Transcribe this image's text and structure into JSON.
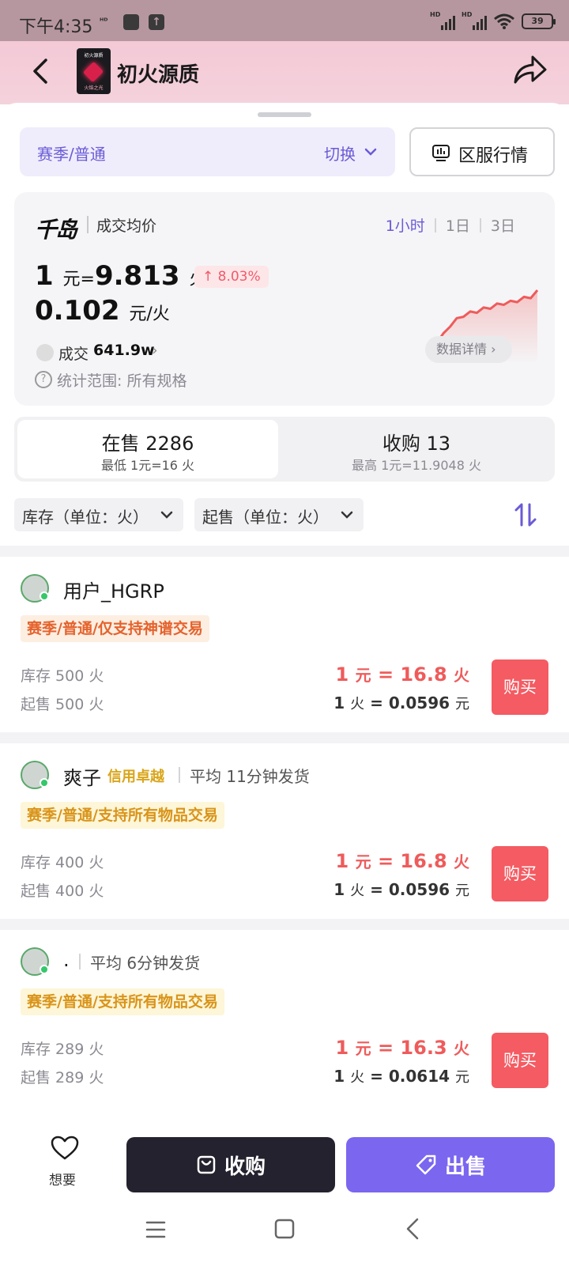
{
  "status": {
    "time": "下午4:35",
    "small_icon": "ᴴᴰ",
    "battery": "39"
  },
  "header": {
    "title": "初火源质",
    "thumb_title": "初火源质",
    "thumb_sub": "火焰之光"
  },
  "filters_top": {
    "season_label": "赛季/普通",
    "switch_label": "切换",
    "server_label": "区服行情"
  },
  "price_card": {
    "brand": "千岛",
    "avg_label": "成交均价",
    "ranges": [
      "1小时",
      "1日",
      "3日"
    ],
    "rate_main_value": "1",
    "rate_main_unit1": "元",
    "rate_main_eq": "=",
    "rate_main_value2": "9.813",
    "rate_main_unit2": "火",
    "change": "↑ 8.03%",
    "rate_second_value": "0.102",
    "rate_second_unit": "元/火",
    "volume_label": "成交",
    "volume_value": "641.9w",
    "volume_chevron": "›",
    "scope_label": "统计范围: 所有规格",
    "detail_label": "数据详情 ›",
    "spark_values": [
      0.05,
      0.2,
      0.35,
      0.45,
      0.58,
      0.6,
      0.68,
      0.66,
      0.74,
      0.72,
      0.8,
      0.78,
      0.84,
      0.82,
      0.9,
      0.88,
      1.0
    ]
  },
  "trade_tabs": {
    "on_sale_title": "在售 2286",
    "on_sale_sub": "最低 1元=16 火",
    "buy_title": "收购 13",
    "buy_sub": "最高 1元=11.9048 火"
  },
  "sort_filters": {
    "stock_filter": "库存（单位：火）",
    "min_filter": "起售（单位：火）"
  },
  "listings": [
    {
      "name": "用户_HGRP",
      "credit": "",
      "ship": "",
      "tag": "赛季/普通/仅支持神谱交易",
      "stock": "库存 500 火",
      "min": "起售 500 火",
      "price1_a": "1",
      "price1_b": "元",
      "price1_c": " = 16.8 ",
      "price1_d": "火",
      "price2_a": "1 ",
      "price2_b": "火",
      "price2_c": " = 0.0596 ",
      "price2_d": "元",
      "buy": "购买"
    },
    {
      "name": "爽子",
      "credit": "信用卓越",
      "ship": "平均 11分钟发货",
      "tag": "赛季/普通/支持所有物品交易",
      "stock": "库存 400 火",
      "min": "起售 400 火",
      "price1_a": "1",
      "price1_b": "元",
      "price1_c": " = 16.8 ",
      "price1_d": "火",
      "price2_a": "1 ",
      "price2_b": "火",
      "price2_c": " = 0.0596 ",
      "price2_d": "元",
      "buy": "购买"
    },
    {
      "name": ".",
      "credit": "",
      "ship": "平均 6分钟发货",
      "tag": "赛季/普通/支持所有物品交易",
      "stock": "库存 289 火",
      "min": "起售 289 火",
      "price1_a": "1",
      "price1_b": "元",
      "price1_c": " = 16.3 ",
      "price1_d": "火",
      "price2_a": "1 ",
      "price2_b": "火",
      "price2_c": " = 0.0614 ",
      "price2_d": "元",
      "buy": "购买"
    }
  ],
  "bottom": {
    "wish_label": "想要",
    "acquire_label": "收购",
    "sell_label": "出售"
  },
  "colors": {
    "accent": "#7b66f0",
    "price_red": "#ef5b5b",
    "buy_button": "#f45b62"
  }
}
